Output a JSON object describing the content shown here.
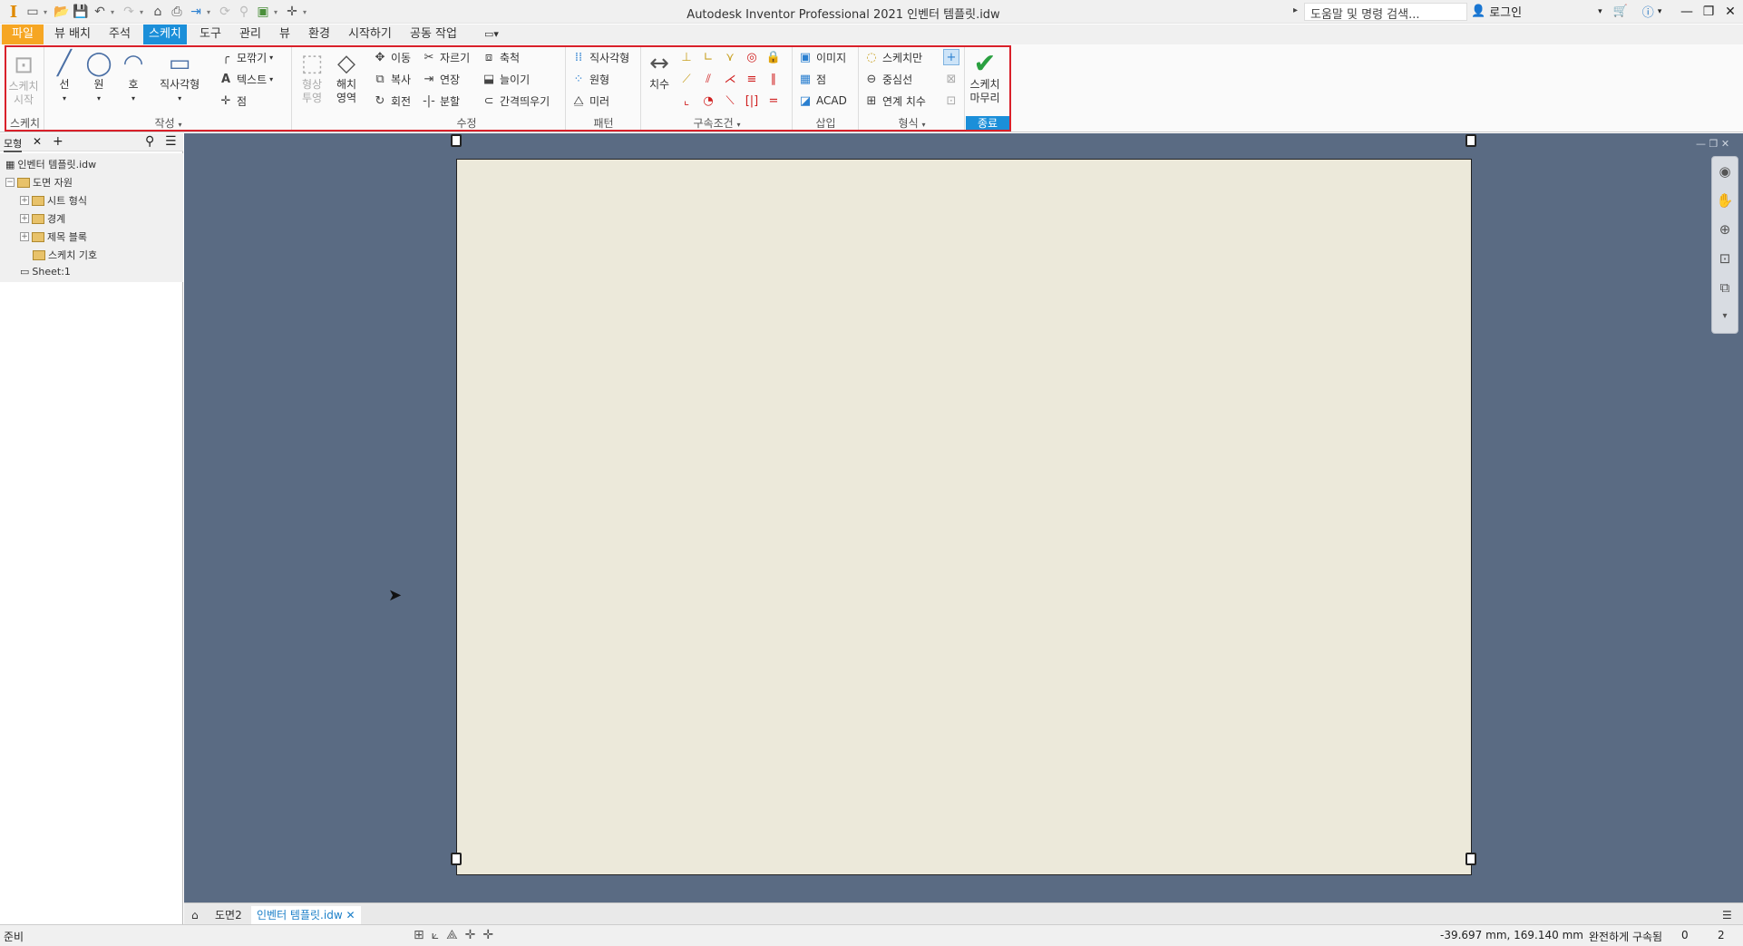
{
  "title": "Autodesk Inventor Professional 2021    인벤터 템플릿.idw",
  "search": {
    "placeholder": "도움말 및 명령 검색..."
  },
  "login": "로그인",
  "tabs": {
    "file": "파일",
    "view_layout": "뷰 배치",
    "annotate": "주석",
    "sketch": "스케치",
    "tools": "도구",
    "manage": "관리",
    "view": "뷰",
    "environments": "환경",
    "getstarted": "시작하기",
    "collaborate": "공동 작업"
  },
  "ribbon": {
    "sketch_panel": {
      "start": "스케치\n시작",
      "label": "스케치"
    },
    "create_panel": {
      "line": "선",
      "circle": "원",
      "arc": "호",
      "rectangle": "직사각형",
      "fillet": "모깎기",
      "text": "텍스트",
      "point": "점",
      "label": "작성"
    },
    "project": "형상\n투영",
    "hatch": "해치\n영역",
    "modify_panel": {
      "move": "이동",
      "trim": "자르기",
      "scale": "축척",
      "copy": "복사",
      "extend": "연장",
      "stretch": "늘이기",
      "rotate": "회전",
      "split": "분할",
      "offset": "간격띄우기",
      "label": "수정"
    },
    "pattern_panel": {
      "rectangular": "직사각형",
      "circular": "원형",
      "mirror": "미러",
      "label": "패턴"
    },
    "constrain_panel": {
      "dimension": "치수",
      "label": "구속조건"
    },
    "insert_panel": {
      "image": "이미지",
      "points": "점",
      "acad": "ACAD",
      "label": "삽입"
    },
    "format_panel": {
      "sketch_only": "스케치만",
      "centerline": "중심선",
      "driven_dim": "연계 치수",
      "label": "형식"
    },
    "exit_panel": {
      "finish": "스케치\n마무리",
      "label": "종료"
    }
  },
  "browser": {
    "tab": "모형",
    "root": "인벤터 템플릿.idw",
    "items": [
      {
        "label": "도면 자원"
      },
      {
        "label": "시트 형식"
      },
      {
        "label": "경계"
      },
      {
        "label": "제목 블록"
      },
      {
        "label": "스케치 기호"
      },
      {
        "label": "Sheet:1"
      }
    ]
  },
  "doc_tabs": [
    "도면2",
    "인벤터 템플릿.idw"
  ],
  "status": {
    "ready": "준비",
    "coords": "-39.697 mm, 169.140 mm",
    "constraint": "완전하게 구속됨",
    "n1": "0",
    "n2": "2"
  },
  "colors": {
    "accent": "#1b8fd9",
    "file_tab": "#f6a623",
    "canvas": "#5a6b83",
    "sheet": "#ece9da",
    "highlight": "#d9202a"
  }
}
